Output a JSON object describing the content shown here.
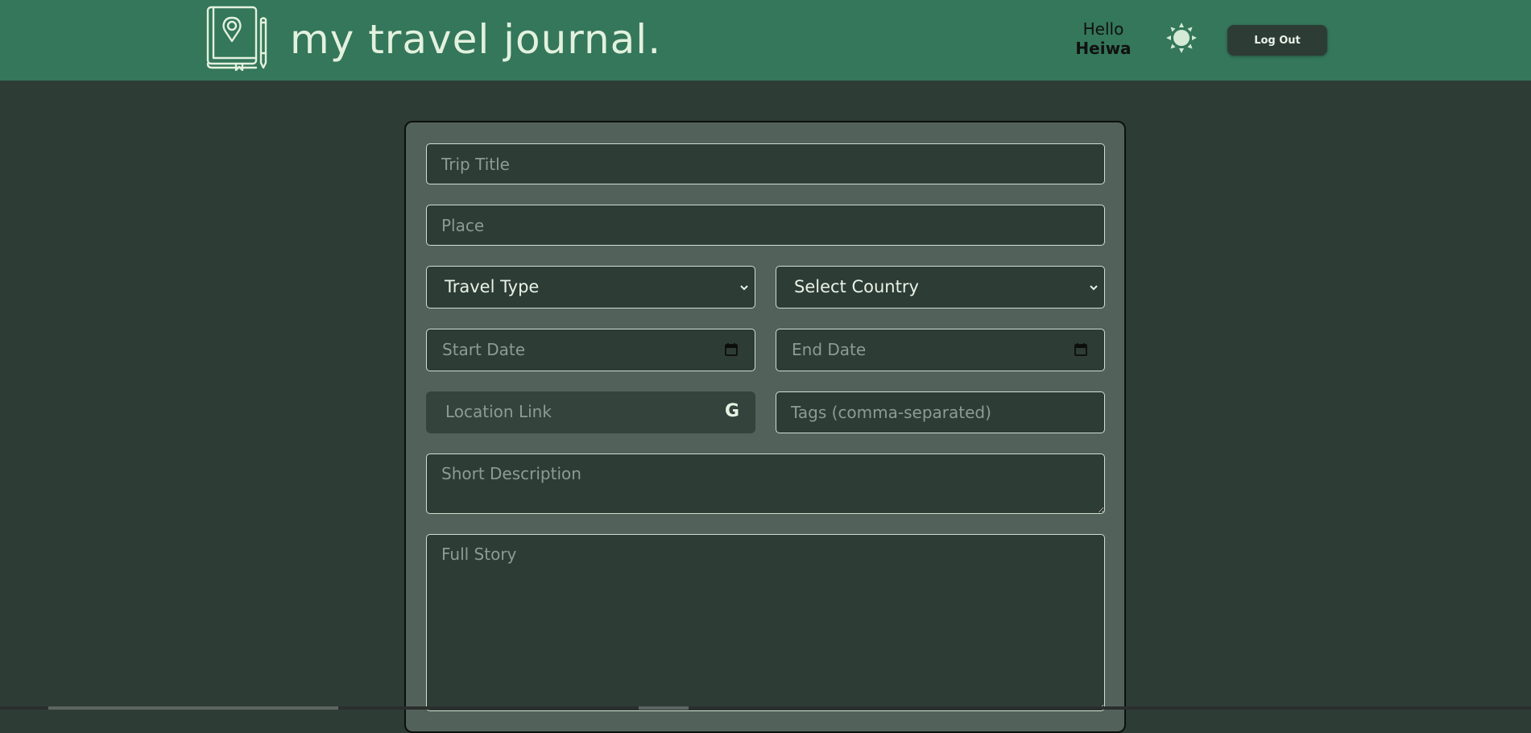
{
  "header": {
    "brand": "my travel journal.",
    "logo_icon": "journal-location-icon",
    "greeting": "Hello",
    "username": "Heiwa",
    "theme_icon": "sun-icon",
    "logout_label": "Log Out",
    "colors": {
      "header_bg": "#34775a",
      "page_bg": "#2e3c36",
      "card_bg": "#53615b",
      "field_bg": "#2e3c36",
      "field_border": "#cfe0d2"
    }
  },
  "form": {
    "trip_title": {
      "placeholder": "Trip Title",
      "value": ""
    },
    "place": {
      "placeholder": "Place",
      "value": ""
    },
    "travel_type": {
      "selected": "Travel Type"
    },
    "country": {
      "selected": "Select Country"
    },
    "start_date": {
      "placeholder": "Start Date"
    },
    "end_date": {
      "placeholder": "End Date"
    },
    "location_link": {
      "placeholder": "Location Link",
      "icon": "google-icon",
      "icon_glyph": "G"
    },
    "tags": {
      "placeholder": "Tags (comma-separated)",
      "value": ""
    },
    "short_description": {
      "placeholder": "Short Description",
      "value": ""
    },
    "full_story": {
      "placeholder": "Full Story",
      "value": ""
    }
  }
}
